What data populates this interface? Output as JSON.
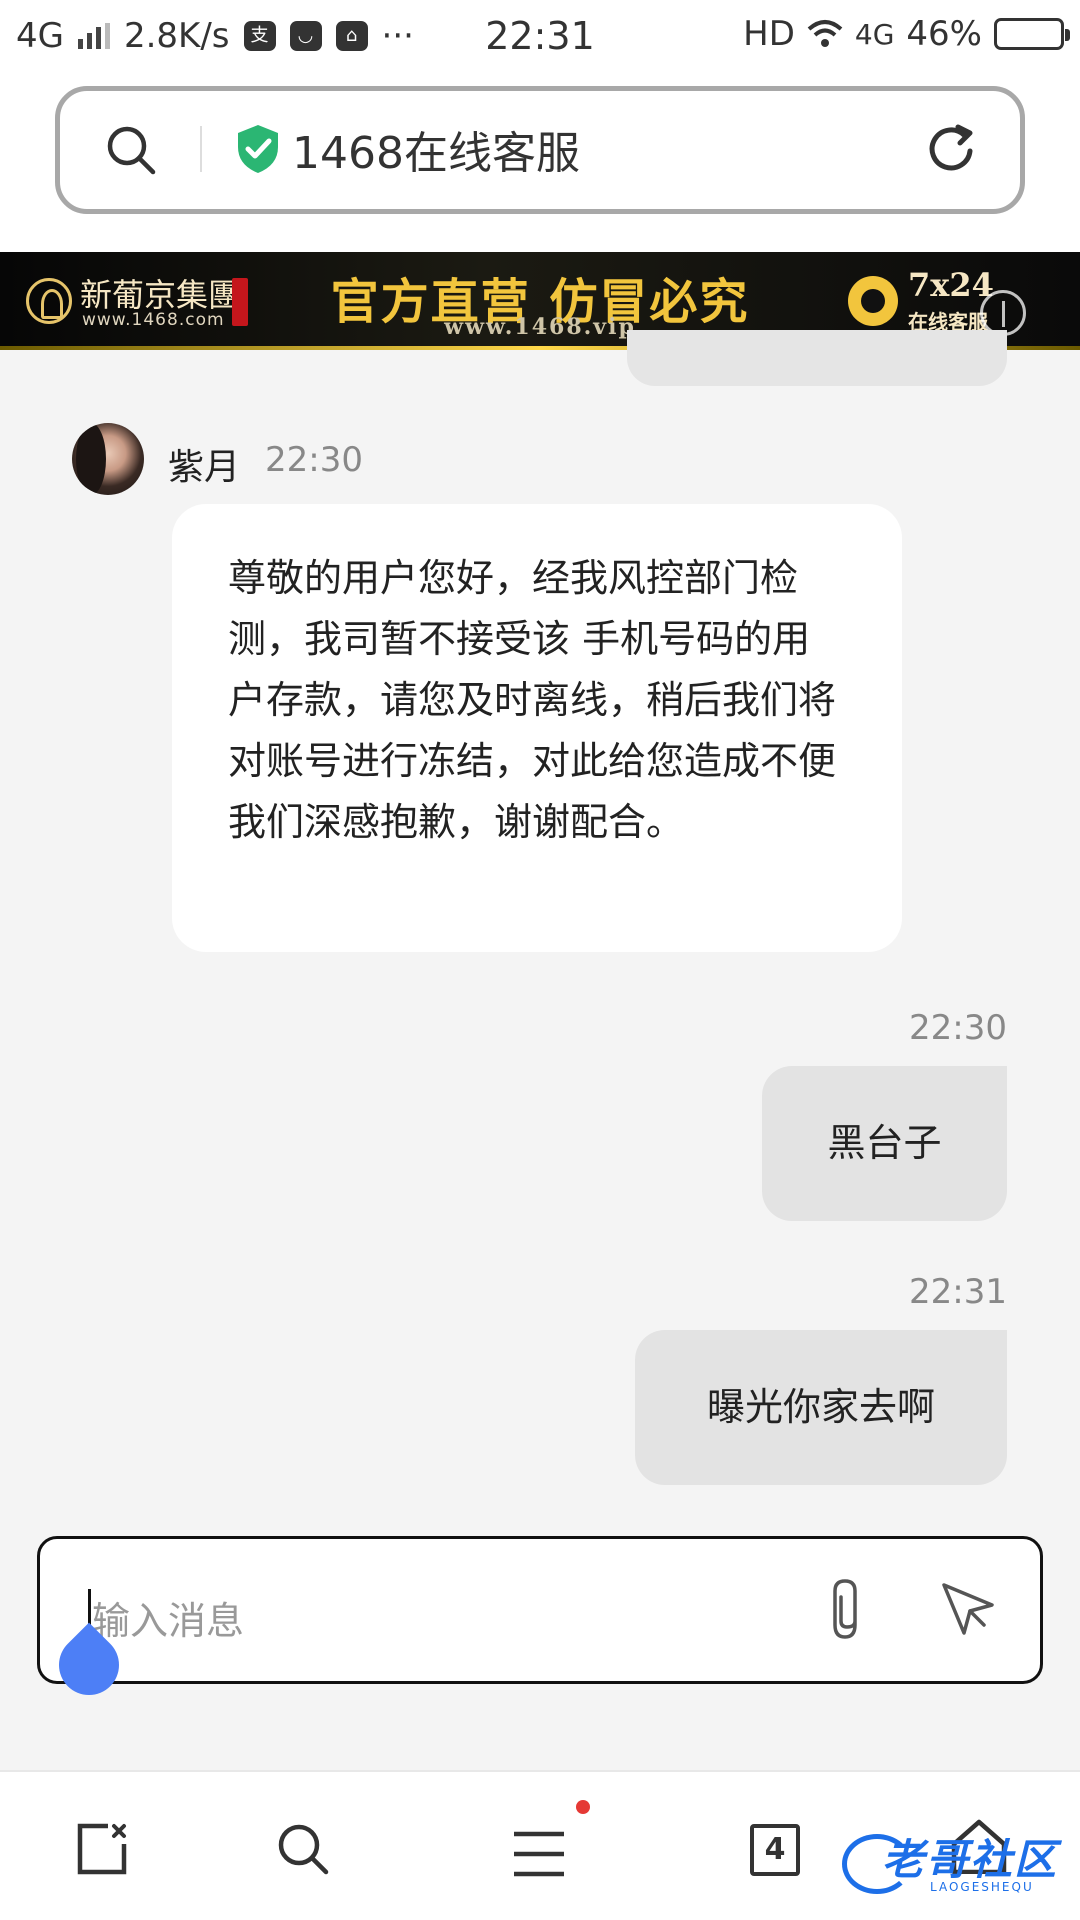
{
  "status_bar": {
    "network": "4G",
    "speed": "2.8K/s",
    "more": "···",
    "time": "22:31",
    "hd": "HD",
    "network_right": "4G",
    "battery": "46%",
    "app_icons": [
      "alipay-icon",
      "notification-icon",
      "shopping-icon"
    ]
  },
  "address_bar": {
    "title": "1468在线客服"
  },
  "banner": {
    "brand": "新葡京集團",
    "brand_url": "www.1468.com",
    "slogan": "官方直营  仿冒必究",
    "url": "www.1468.vip",
    "service": "7x24",
    "service_sub": "在线客服"
  },
  "chat": {
    "agent": {
      "name": "紫月",
      "time": "22:30",
      "message": "尊敬的用户您好，经我风控部门检测，我司暂不接受该 手机号码的用户存款，请您及时离线，稍后我们将对账号进行冻结，对此给您造成不便我们深感抱歉，谢谢配合。"
    },
    "outgoing": [
      {
        "time": "22:30",
        "text": "黑台子"
      },
      {
        "time": "22:31",
        "text": "曝光你家去啊"
      }
    ]
  },
  "composer": {
    "placeholder": "输入消息"
  },
  "bottom_nav": {
    "tab_count": "4"
  },
  "watermark": {
    "text": "老哥社区",
    "sub": "LAOGESHEQU"
  },
  "colors": {
    "background": "#f4f4f4",
    "incoming_bubble": "#ffffff",
    "outgoing_bubble": "#e3e3e3",
    "shield": "#2bb673",
    "slogan_gold": "#f2c53d",
    "cursor_drop": "#4d7ff6",
    "watermark": "#1d6fe8"
  }
}
